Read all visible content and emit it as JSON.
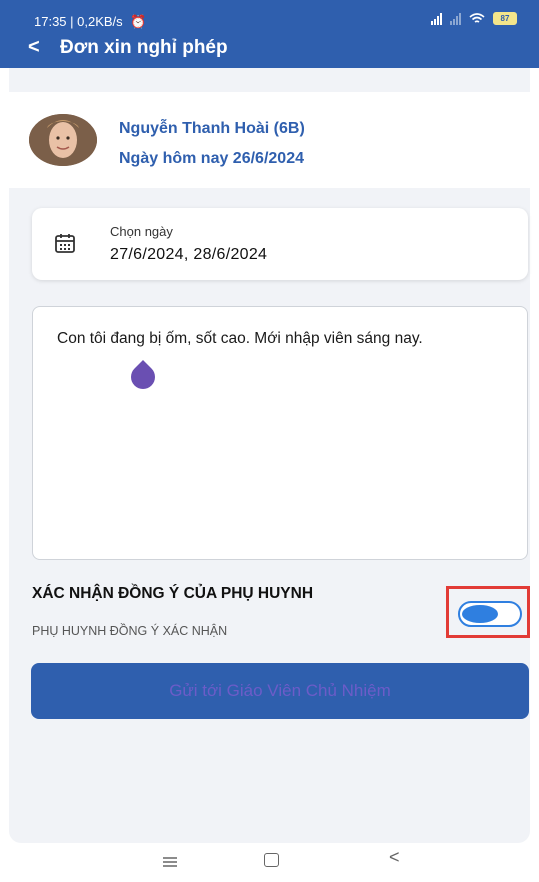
{
  "status_bar": {
    "time": "17:35 | 0,2KB/s",
    "battery": "87"
  },
  "header": {
    "title": "Đơn xin nghỉ phép"
  },
  "profile": {
    "name": "Nguyễn Thanh Hoài (6B)",
    "today": "Ngày hôm nay 26/6/2024"
  },
  "date_picker": {
    "label": "Chọn ngày",
    "value": "27/6/2024, 28/6/2024"
  },
  "reason": {
    "text": "Con tôi đang bị ốm, sốt cao. Mới nhập viên sáng nay."
  },
  "consent": {
    "title": "XÁC NHẬN ĐỒNG Ý CỦA PHỤ HUYNH",
    "subtitle": "PHỤ HUYNH ĐỒNG Ý XÁC NHẬN",
    "enabled": true
  },
  "submit": {
    "label": "Gửi tới Giáo Viên Chủ Nhiệm"
  },
  "colors": {
    "primary": "#2f5fae",
    "toggle": "#2f7fe0",
    "highlight": "#e23b36"
  },
  "icons": [
    "back-arrow-icon",
    "calendar-icon",
    "alarm-icon",
    "signal-icon",
    "wifi-icon",
    "battery-icon",
    "menu-icon",
    "home-icon",
    "back-icon"
  ]
}
